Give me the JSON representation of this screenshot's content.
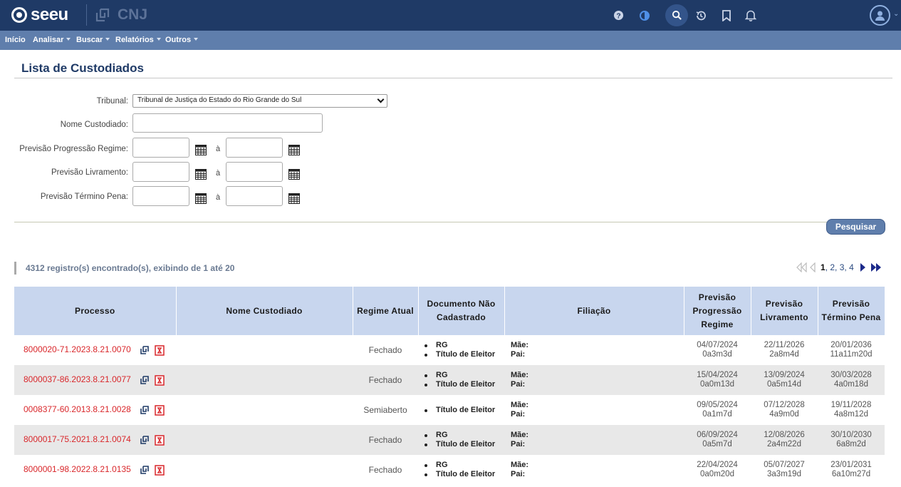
{
  "header": {
    "brand": "seeu",
    "partner": "CNJ",
    "icons": [
      "help-icon",
      "contrast-icon",
      "search-icon",
      "history-icon",
      "bookmark-icon",
      "bell-icon",
      "user-icon"
    ],
    "colors": {
      "topbar": "#1f3a66",
      "menubar": "#5f7eac",
      "accent_red": "#d9262a"
    }
  },
  "menu": {
    "items": [
      {
        "label": "Início",
        "dropdown": false
      },
      {
        "label": "Analisar",
        "dropdown": true
      },
      {
        "label": "Buscar",
        "dropdown": true
      },
      {
        "label": "Relatórios",
        "dropdown": true
      },
      {
        "label": "Outros",
        "dropdown": true
      }
    ]
  },
  "page": {
    "title": "Lista de Custodiados"
  },
  "form": {
    "tribunal_label": "Tribunal:",
    "tribunal_value": "Tribunal de Justiça do Estado do Rio Grande do Sul",
    "nome_label": "Nome Custodiado:",
    "nome_value": "",
    "progressao_label": "Previsão Progressão Regime:",
    "livramento_label": "Previsão Livramento:",
    "termino_label": "Previsão Término Pena:",
    "range_sep": "à",
    "search_button": "Pesquisar"
  },
  "results": {
    "summary": "4312 registro(s) encontrado(s), exibindo de 1 até 20",
    "pagination": {
      "current": "1",
      "pages": [
        "2",
        "3",
        "4"
      ]
    }
  },
  "table": {
    "headers": {
      "processo": "Processo",
      "nome": "Nome Custodiado",
      "regime": "Regime Atual",
      "documento_1": "Documento Não",
      "documento_2": "Cadastrado",
      "filiacao": "Filiação",
      "progressao_1": "Previsão",
      "progressao_2": "Progressão",
      "progressao_3": "Regime",
      "livramento_1": "Previsão",
      "livramento_2": "Livramento",
      "termino_1": "Previsão",
      "termino_2": "Término Pena"
    },
    "mae_label": "Mãe:",
    "pai_label": "Pai:",
    "rows": [
      {
        "processo": "8000020-71.2023.8.21.0070",
        "nome": "",
        "regime": "Fechado",
        "docs": [
          "RG",
          "Título de Eleitor"
        ],
        "prog_date": "04/07/2024",
        "prog_dur": "0a3m3d",
        "liv_date": "22/11/2026",
        "liv_dur": "2a8m4d",
        "term_date": "20/01/2036",
        "term_dur": "11a11m20d"
      },
      {
        "processo": "8000037-86.2023.8.21.0077",
        "nome": "",
        "regime": "Fechado",
        "docs": [
          "RG",
          "Título de Eleitor"
        ],
        "prog_date": "15/04/2024",
        "prog_dur": "0a0m13d",
        "liv_date": "13/09/2024",
        "liv_dur": "0a5m14d",
        "term_date": "30/03/2028",
        "term_dur": "4a0m18d"
      },
      {
        "processo": "0008377-60.2013.8.21.0028",
        "nome": "",
        "regime": "Semiaberto",
        "docs": [
          "Título de Eleitor"
        ],
        "prog_date": "09/05/2024",
        "prog_dur": "0a1m7d",
        "liv_date": "07/12/2028",
        "liv_dur": "4a9m0d",
        "term_date": "19/11/2028",
        "term_dur": "4a8m12d"
      },
      {
        "processo": "8000017-75.2021.8.21.0074",
        "nome": "",
        "regime": "Fechado",
        "docs": [
          "RG",
          "Título de Eleitor"
        ],
        "prog_date": "06/09/2024",
        "prog_dur": "0a5m7d",
        "liv_date": "12/08/2026",
        "liv_dur": "2a4m22d",
        "term_date": "30/10/2030",
        "term_dur": "6a8m2d"
      },
      {
        "processo": "8000001-98.2022.8.21.0135",
        "nome": "",
        "regime": "Fechado",
        "docs": [
          "RG",
          "Título de Eleitor"
        ],
        "prog_date": "22/04/2024",
        "prog_dur": "0a0m20d",
        "liv_date": "05/07/2027",
        "liv_dur": "3a3m19d",
        "term_date": "23/01/2031",
        "term_dur": "6a10m27d"
      }
    ]
  }
}
